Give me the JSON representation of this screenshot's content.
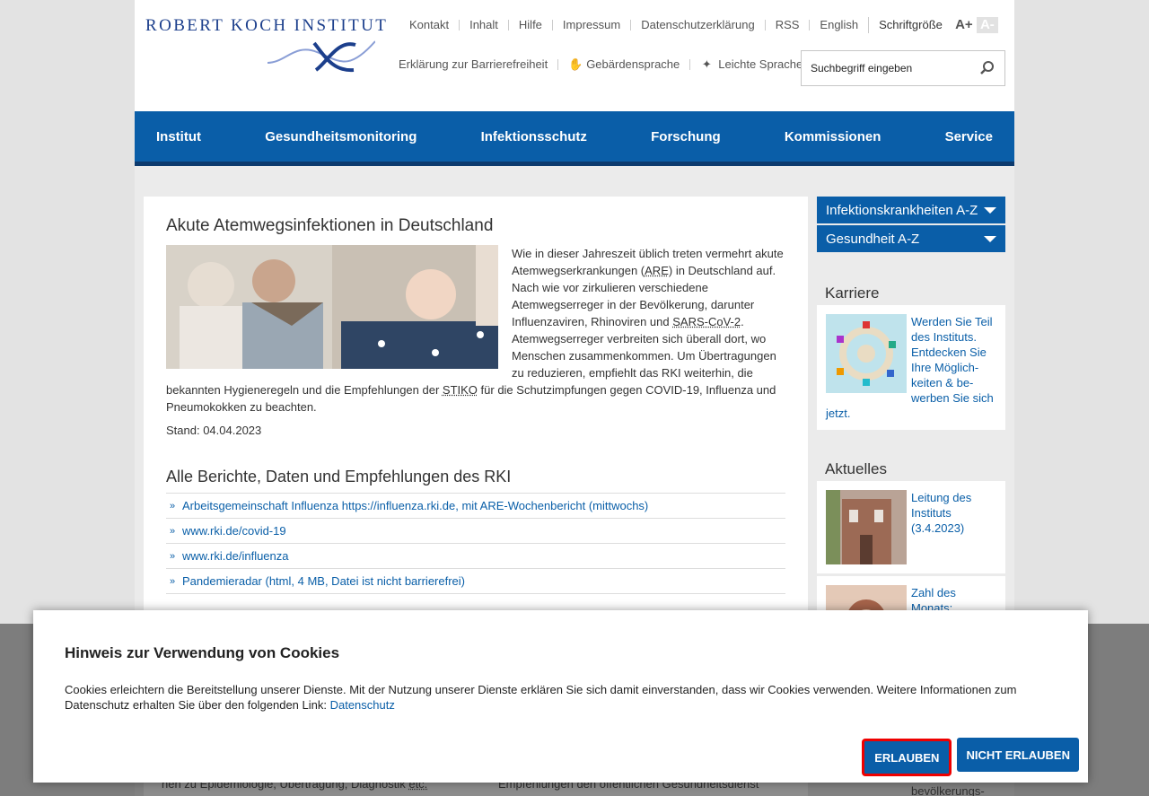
{
  "header": {
    "logo_text": "ROBERT KOCH INSTITUT",
    "topnav": [
      "Kontakt",
      "Inhalt",
      "Hilfe",
      "Impressum",
      "Datenschutzerklärung",
      "RSS",
      "English"
    ],
    "fontsize_label": "Schriftgröße",
    "fontsize_increase": "A+",
    "fontsize_decrease": "A-",
    "accessibility": "Erklärung zur Barrierefreiheit",
    "sign_language": "Gebärdensprache",
    "easy_language": "Leichte Sprache",
    "search_placeholder": "Suchbegriff eingeben"
  },
  "mainnav": [
    "Institut",
    "Gesundheitsmonitoring",
    "Infektionsschutz",
    "Forschung",
    "Kommissionen",
    "Service"
  ],
  "article": {
    "title": "Akute Atemwegsinfektionen in Deutschland",
    "text_1": "Wie in dieser Jahreszeit üblich treten vermehrt akute Atemwegserkrankungen (",
    "abbr_are": "ARE",
    "text_2": ") in Deutschland auf. Nach wie vor zirkulieren verschiedene Atemwegserreger in der Bevölkerung, darunter Influenzaviren, Rhinoviren und ",
    "abbr_sars": "SARS-CoV-2",
    "text_3": ". Atemwegserreger verbreiten sich überall dort, wo Menschen zusammenkommen. Um Übertragungen zu reduzieren, empfiehlt das RKI weiterhin, die bekannten Hygieneregeln und die Empfehlungen der ",
    "abbr_stiko": "STIKO",
    "text_4": " für die Schutzimpfungen gegen COVID-19, Influenza und Pneumokokken zu beachten.",
    "stand": "Stand: 04.04.2023"
  },
  "reports": {
    "title": "Alle Berichte, Daten und Empfehlungen des RKI",
    "links": [
      "Arbeitsgemeinschaft Influenza https://influenza.rki.de, mit ARE-Wochenbericht (mittwochs)",
      "www.rki.de/covid-19",
      "www.rki.de/influenza",
      "Pandemieradar (html, 4 MB, Datei ist nicht barrierefrei)"
    ]
  },
  "sidebar": {
    "dropdowns": [
      "Infektionskrankheiten A-Z",
      "Gesundheit A-Z"
    ],
    "career_title": "Karriere",
    "career_text": "Werden Sie Teil des Instituts. Entdecken Sie Ihre Möglich­keiten & be­werben Sie sich jetzt.",
    "news_title": "Aktuelles",
    "news_1": "Leitung des Instituts (3.4.2023)",
    "news_2": "Zahl des Monats:",
    "news_2_tail": "bevölkerungs-"
  },
  "peek": {
    "left": "hen zu Epidemiologie, Übertragung, Diagnostik",
    "left_abbr": "etc.",
    "mid": "Empfehlungen den öffentlichen Gesundheitsdienst"
  },
  "cookie": {
    "title": "Hinweis zur Verwendung von Cookies",
    "text": "Cookies erleichtern die Bereitstellung unserer Dienste. Mit der Nutzung unserer Dienste erklären Sie sich damit einverstanden, dass wir Cookies verwenden. Weitere Informationen zum Datenschutz erhalten Sie über den folgenden Link: ",
    "link": "Datenschutz",
    "allow": "ERLAUBEN",
    "deny": "NICHT ERLAUBEN"
  }
}
